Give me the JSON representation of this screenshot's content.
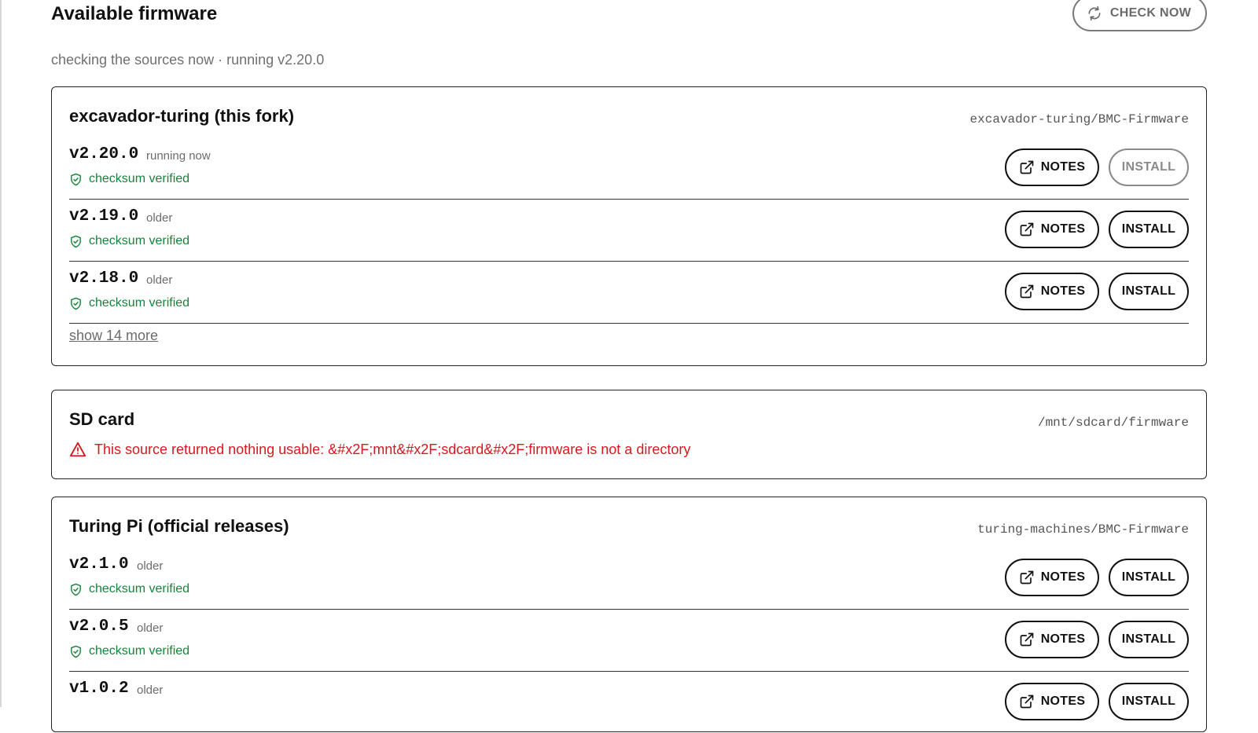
{
  "header": {
    "title": "Available firmware",
    "subtitle": "checking the sources now · running v2.20.0",
    "check_now_label": "CHECK NOW"
  },
  "sources": [
    {
      "title": "excavador-turing (this fork)",
      "path": "excavador-turing/BMC-Firmware",
      "releases": [
        {
          "version": "v2.20.0",
          "status": "running now",
          "checksum": "checksum verified",
          "notes_label": "NOTES",
          "install_label": "INSTALL",
          "install_enabled": false
        },
        {
          "version": "v2.19.0",
          "status": "older",
          "checksum": "checksum verified",
          "notes_label": "NOTES",
          "install_label": "INSTALL",
          "install_enabled": true
        },
        {
          "version": "v2.18.0",
          "status": "older",
          "checksum": "checksum verified",
          "notes_label": "NOTES",
          "install_label": "INSTALL",
          "install_enabled": true
        }
      ],
      "show_more_label": "show 14 more"
    },
    {
      "title": "SD card",
      "path": "/mnt/sdcard/firmware",
      "error": "This source returned nothing usable: &#x2F;mnt&#x2F;sdcard&#x2F;firmware is not a directory"
    },
    {
      "title": "Turing Pi (official releases)",
      "path": "turing-machines/BMC-Firmware",
      "releases": [
        {
          "version": "v2.1.0",
          "status": "older",
          "checksum": "checksum verified",
          "notes_label": "NOTES",
          "install_label": "INSTALL",
          "install_enabled": true
        },
        {
          "version": "v2.0.5",
          "status": "older",
          "checksum": "checksum verified",
          "notes_label": "NOTES",
          "install_label": "INSTALL",
          "install_enabled": true
        },
        {
          "version": "v1.0.2",
          "status": "older",
          "checksum": "",
          "notes_label": "NOTES",
          "install_label": "INSTALL",
          "install_enabled": true
        }
      ]
    }
  ],
  "colors": {
    "verified": "#16833a",
    "error": "#d71920",
    "muted": "#6c6c6c"
  },
  "icons": {
    "check_now": "refresh-icon",
    "notes": "external-link-icon",
    "verified": "shield-check-icon",
    "error": "warning-triangle-icon"
  }
}
